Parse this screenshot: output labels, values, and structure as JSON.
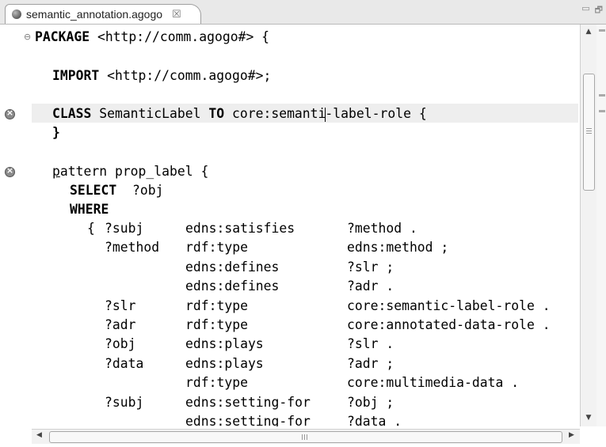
{
  "tab": {
    "icon": "source-file-icon",
    "label": "semantic_annotation.agogo",
    "close_glyph": "☒"
  },
  "window_controls": {
    "minimize": "▭",
    "maximize": "🗗"
  },
  "code": {
    "l1": {
      "kw": "PACKAGE",
      "rest": " <http://comm.agogo#> {"
    },
    "l2": {
      "kw": "IMPORT",
      "rest": " <http://comm.agogo#>;"
    },
    "l3": {
      "kw1": "CLASS",
      "mid": " SemanticLabel ",
      "kw2": "TO",
      "pre_caret": " core:semanti",
      "post_caret": "-label-role {"
    },
    "l4": "}",
    "l5": {
      "p_underlined": "p",
      "rest": "attern prop_label {"
    },
    "l6": {
      "kw": "SELECT",
      "rest": "  ?obj"
    },
    "l7": {
      "kw": "WHERE"
    },
    "triples": [
      {
        "pre": "{ ",
        "s": "?subj",
        "p": "edns:satisfies",
        "o": "?method ."
      },
      {
        "pre": "",
        "s": "?method",
        "p": "rdf:type",
        "o": "edns:method ;"
      },
      {
        "pre": "",
        "s": "",
        "p": "edns:defines",
        "o": "?slr ;"
      },
      {
        "pre": "",
        "s": "",
        "p": "edns:defines",
        "o": "?adr ."
      },
      {
        "pre": "",
        "s": "?slr",
        "p": "rdf:type",
        "o": "core:semantic-label-role ."
      },
      {
        "pre": "",
        "s": "?adr",
        "p": "rdf:type",
        "o": "core:annotated-data-role ."
      },
      {
        "pre": "",
        "s": "?obj",
        "p": "edns:plays",
        "o": "?slr ."
      },
      {
        "pre": "",
        "s": "?data",
        "p": "edns:plays",
        "o": "?adr ;"
      },
      {
        "pre": "",
        "s": "",
        "p": "rdf:type",
        "o": "core:multimedia-data ."
      },
      {
        "pre": "",
        "s": "?subj",
        "p": "edns:setting-for",
        "o": "?obj ;"
      },
      {
        "pre": "",
        "s": "",
        "p": "edns:setting-for",
        "o": "?data ."
      }
    ]
  },
  "gutter": {
    "fold_icon": "⊖",
    "error_icon": "error-marker-icon"
  },
  "scrollbars": {
    "up": "▲",
    "down": "▼",
    "left": "◀",
    "right": "▶",
    "h_grip": "III"
  }
}
